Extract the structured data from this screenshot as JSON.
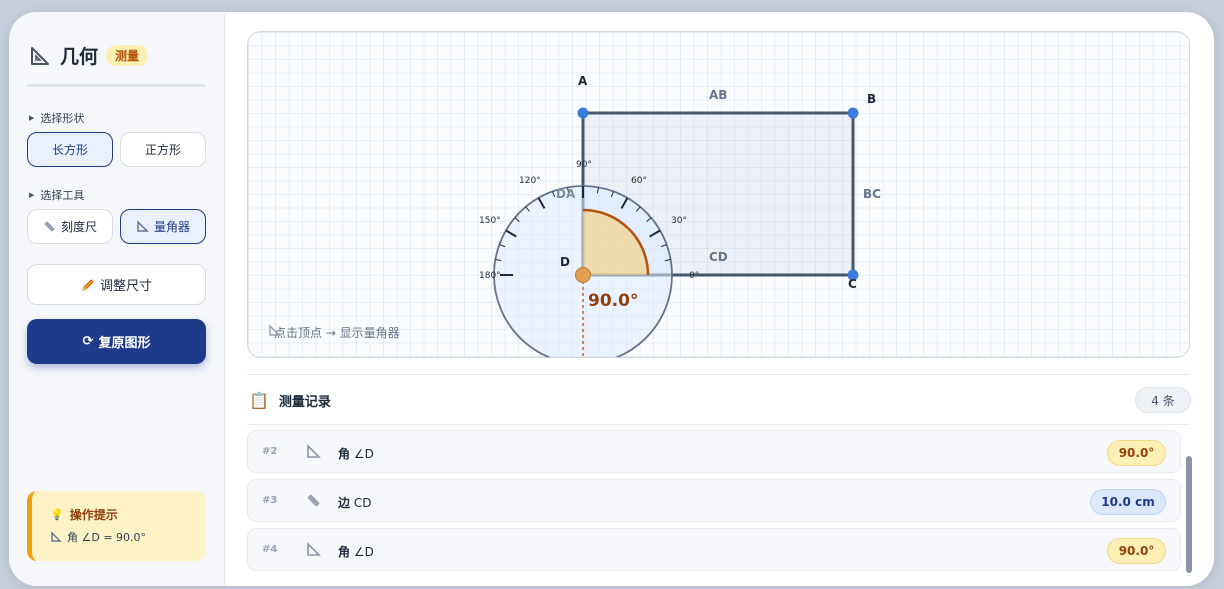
{
  "brand": {
    "title": "几何",
    "badge": "测量"
  },
  "sidebar": {
    "shape_label": "选择形状",
    "shapes": [
      {
        "label": "长方形",
        "active": true
      },
      {
        "label": "正方形",
        "active": false
      }
    ],
    "tool_label": "选择工具",
    "tools": [
      {
        "label": "刻度尺",
        "icon": "ruler-icon",
        "active": false
      },
      {
        "label": "量角器",
        "icon": "protractor-icon",
        "active": true
      }
    ],
    "resize_label": "调整尺寸",
    "reset_label": "复原图形"
  },
  "tip": {
    "title": "操作提示",
    "text": "角 ∠D = 90.0°"
  },
  "canvas": {
    "vertices": {
      "a": "A",
      "b": "B",
      "c": "C",
      "d": "D"
    },
    "edges": {
      "ab": "AB",
      "bc": "BC",
      "cd": "CD",
      "da": "DA"
    },
    "protractor_ticks": [
      "180°",
      "150°",
      "120°",
      "90°",
      "60°",
      "30°",
      "0°"
    ],
    "angle_reading": "90.0°",
    "hint": "点击顶点 → 显示量角器"
  },
  "records": {
    "title": "测量记录",
    "count": "4 条",
    "rows": [
      {
        "index": "#2",
        "icon": "protractor-icon",
        "type": "角",
        "target": "∠D",
        "value": "90.0°",
        "kind": "angle"
      },
      {
        "index": "#3",
        "icon": "ruler-icon",
        "type": "边",
        "target": "CD",
        "value": "10.0 cm",
        "kind": "length"
      },
      {
        "index": "#4",
        "icon": "protractor-icon",
        "type": "角",
        "target": "∠D",
        "value": "90.0°",
        "kind": "angle"
      }
    ]
  },
  "colors": {
    "primary": "#1e3a8a",
    "accent_amber": "#f59e0b",
    "vertex_blue": "#3b7ddd",
    "angle_arc": "#b45309"
  }
}
